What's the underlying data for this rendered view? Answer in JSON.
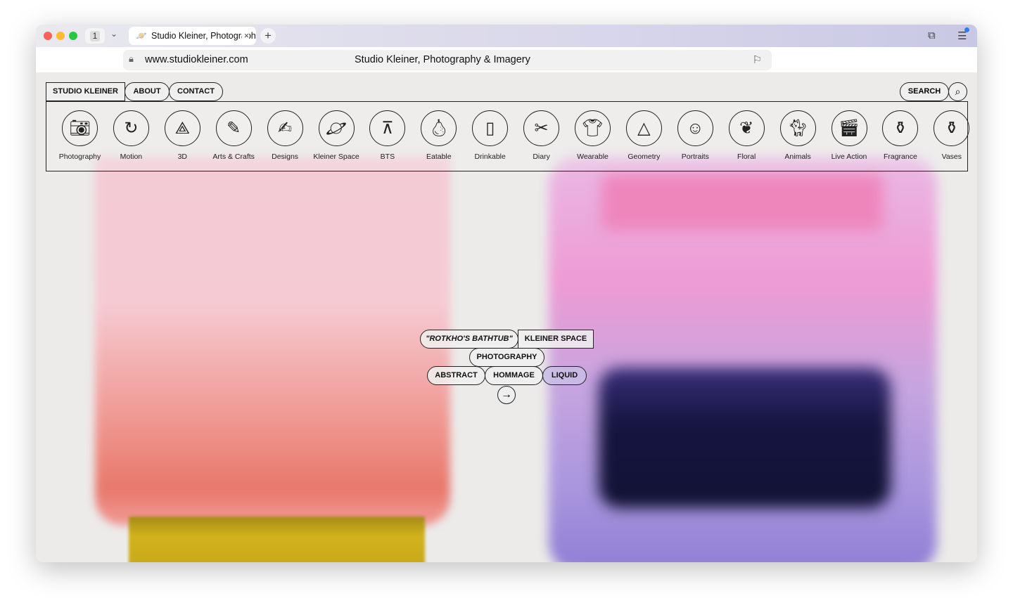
{
  "browser": {
    "tab_count": "1",
    "tab_title": "Studio Kleiner, Photography & Imagery",
    "url": "www.studiokleiner.com",
    "page_title": "Studio Kleiner, Photography & Imagery"
  },
  "nav": {
    "brand": "STUDIO KLEINER",
    "about": "ABOUT",
    "contact": "CONTACT",
    "search": "SEARCH"
  },
  "categories": [
    {
      "label": "Photography",
      "icon": "camera-icon"
    },
    {
      "label": "Motion",
      "icon": "motion-icon"
    },
    {
      "label": "3D",
      "icon": "3d-axes-icon"
    },
    {
      "label": "Arts & Crafts",
      "icon": "brush-icon"
    },
    {
      "label": "Designs",
      "icon": "hand-pen-icon"
    },
    {
      "label": "Kleiner Space",
      "icon": "planet-icon"
    },
    {
      "label": "BTS",
      "icon": "light-stand-icon"
    },
    {
      "label": "Eatable",
      "icon": "pear-icon"
    },
    {
      "label": "Drinkable",
      "icon": "glass-icon"
    },
    {
      "label": "Diary",
      "icon": "diary-icon"
    },
    {
      "label": "Wearable",
      "icon": "tshirt-icon"
    },
    {
      "label": "Geometry",
      "icon": "pyramid-icon"
    },
    {
      "label": "Portraits",
      "icon": "smiley-icon"
    },
    {
      "label": "Floral",
      "icon": "leaf-icon"
    },
    {
      "label": "Animals",
      "icon": "cat-icon"
    },
    {
      "label": "Live Action",
      "icon": "clapperboard-icon"
    },
    {
      "label": "Fragrance",
      "icon": "perfume-icon"
    },
    {
      "label": "Vases",
      "icon": "vase-icon"
    }
  ],
  "feature": {
    "title": "\"ROTKHO'S BATHTUB\"",
    "section": "KLEINER SPACE",
    "type": "PHOTOGRAPHY",
    "tags": [
      "ABSTRACT",
      "HOMMAGE",
      "LIQUID"
    ]
  }
}
